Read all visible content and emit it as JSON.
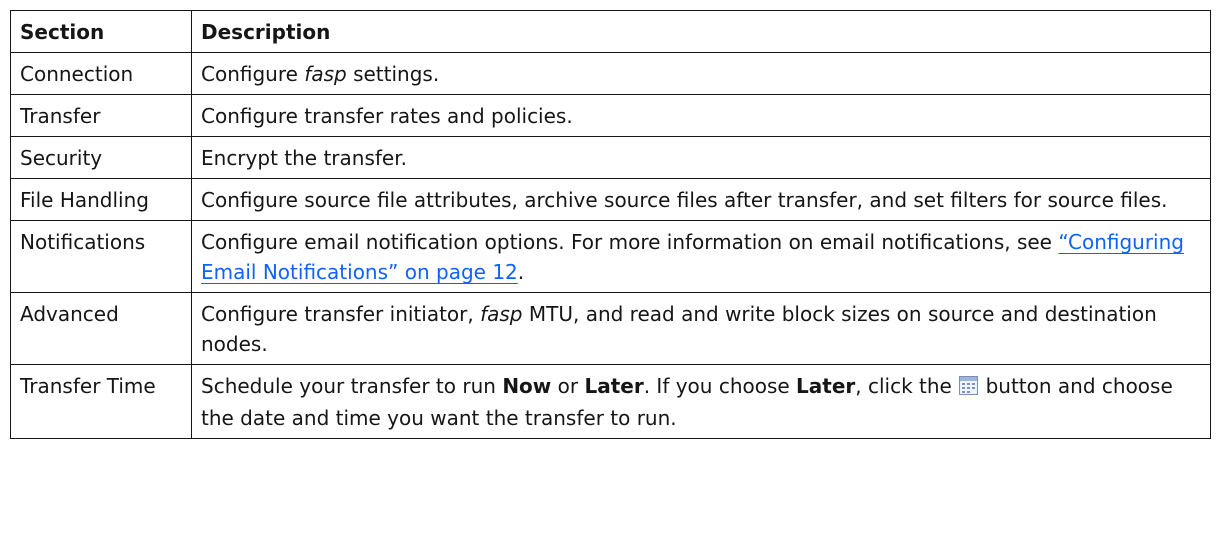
{
  "table": {
    "headers": {
      "section": "Section",
      "description": "Description"
    },
    "rows": {
      "connection": {
        "section": "Connection",
        "d1": "Configure ",
        "d1_em": "fasp",
        "d1_end": " settings."
      },
      "transfer": {
        "section": "Transfer",
        "description": "Configure transfer rates and policies."
      },
      "security": {
        "section": "Security",
        "description": "Encrypt the transfer."
      },
      "file_handling": {
        "section": "File Handling",
        "description": "Configure source file attributes, archive source files after transfer, and set filters for source files."
      },
      "notifications": {
        "section": "Notifications",
        "description": "Configure email notification options. For more information on email notifications, see ",
        "link": "“Configuring Email Notifications” on page 12",
        "end": "."
      },
      "advanced": {
        "section": "Advanced",
        "d1": "Configure transfer initiator, ",
        "d1_em": "fasp",
        "d1_end": " MTU, and read and write block sizes on source and destination nodes."
      },
      "transfer_time": {
        "section": "Transfer Time",
        "t1": "Schedule your transfer to run ",
        "now": "Now",
        "t2": " or ",
        "later": "Later",
        "t3": ". If you choose ",
        "later2": "Later",
        "t4": ", click the ",
        "icon": "calendar-icon",
        "t5": " button and choose the date and time you want the transfer to run."
      }
    }
  }
}
